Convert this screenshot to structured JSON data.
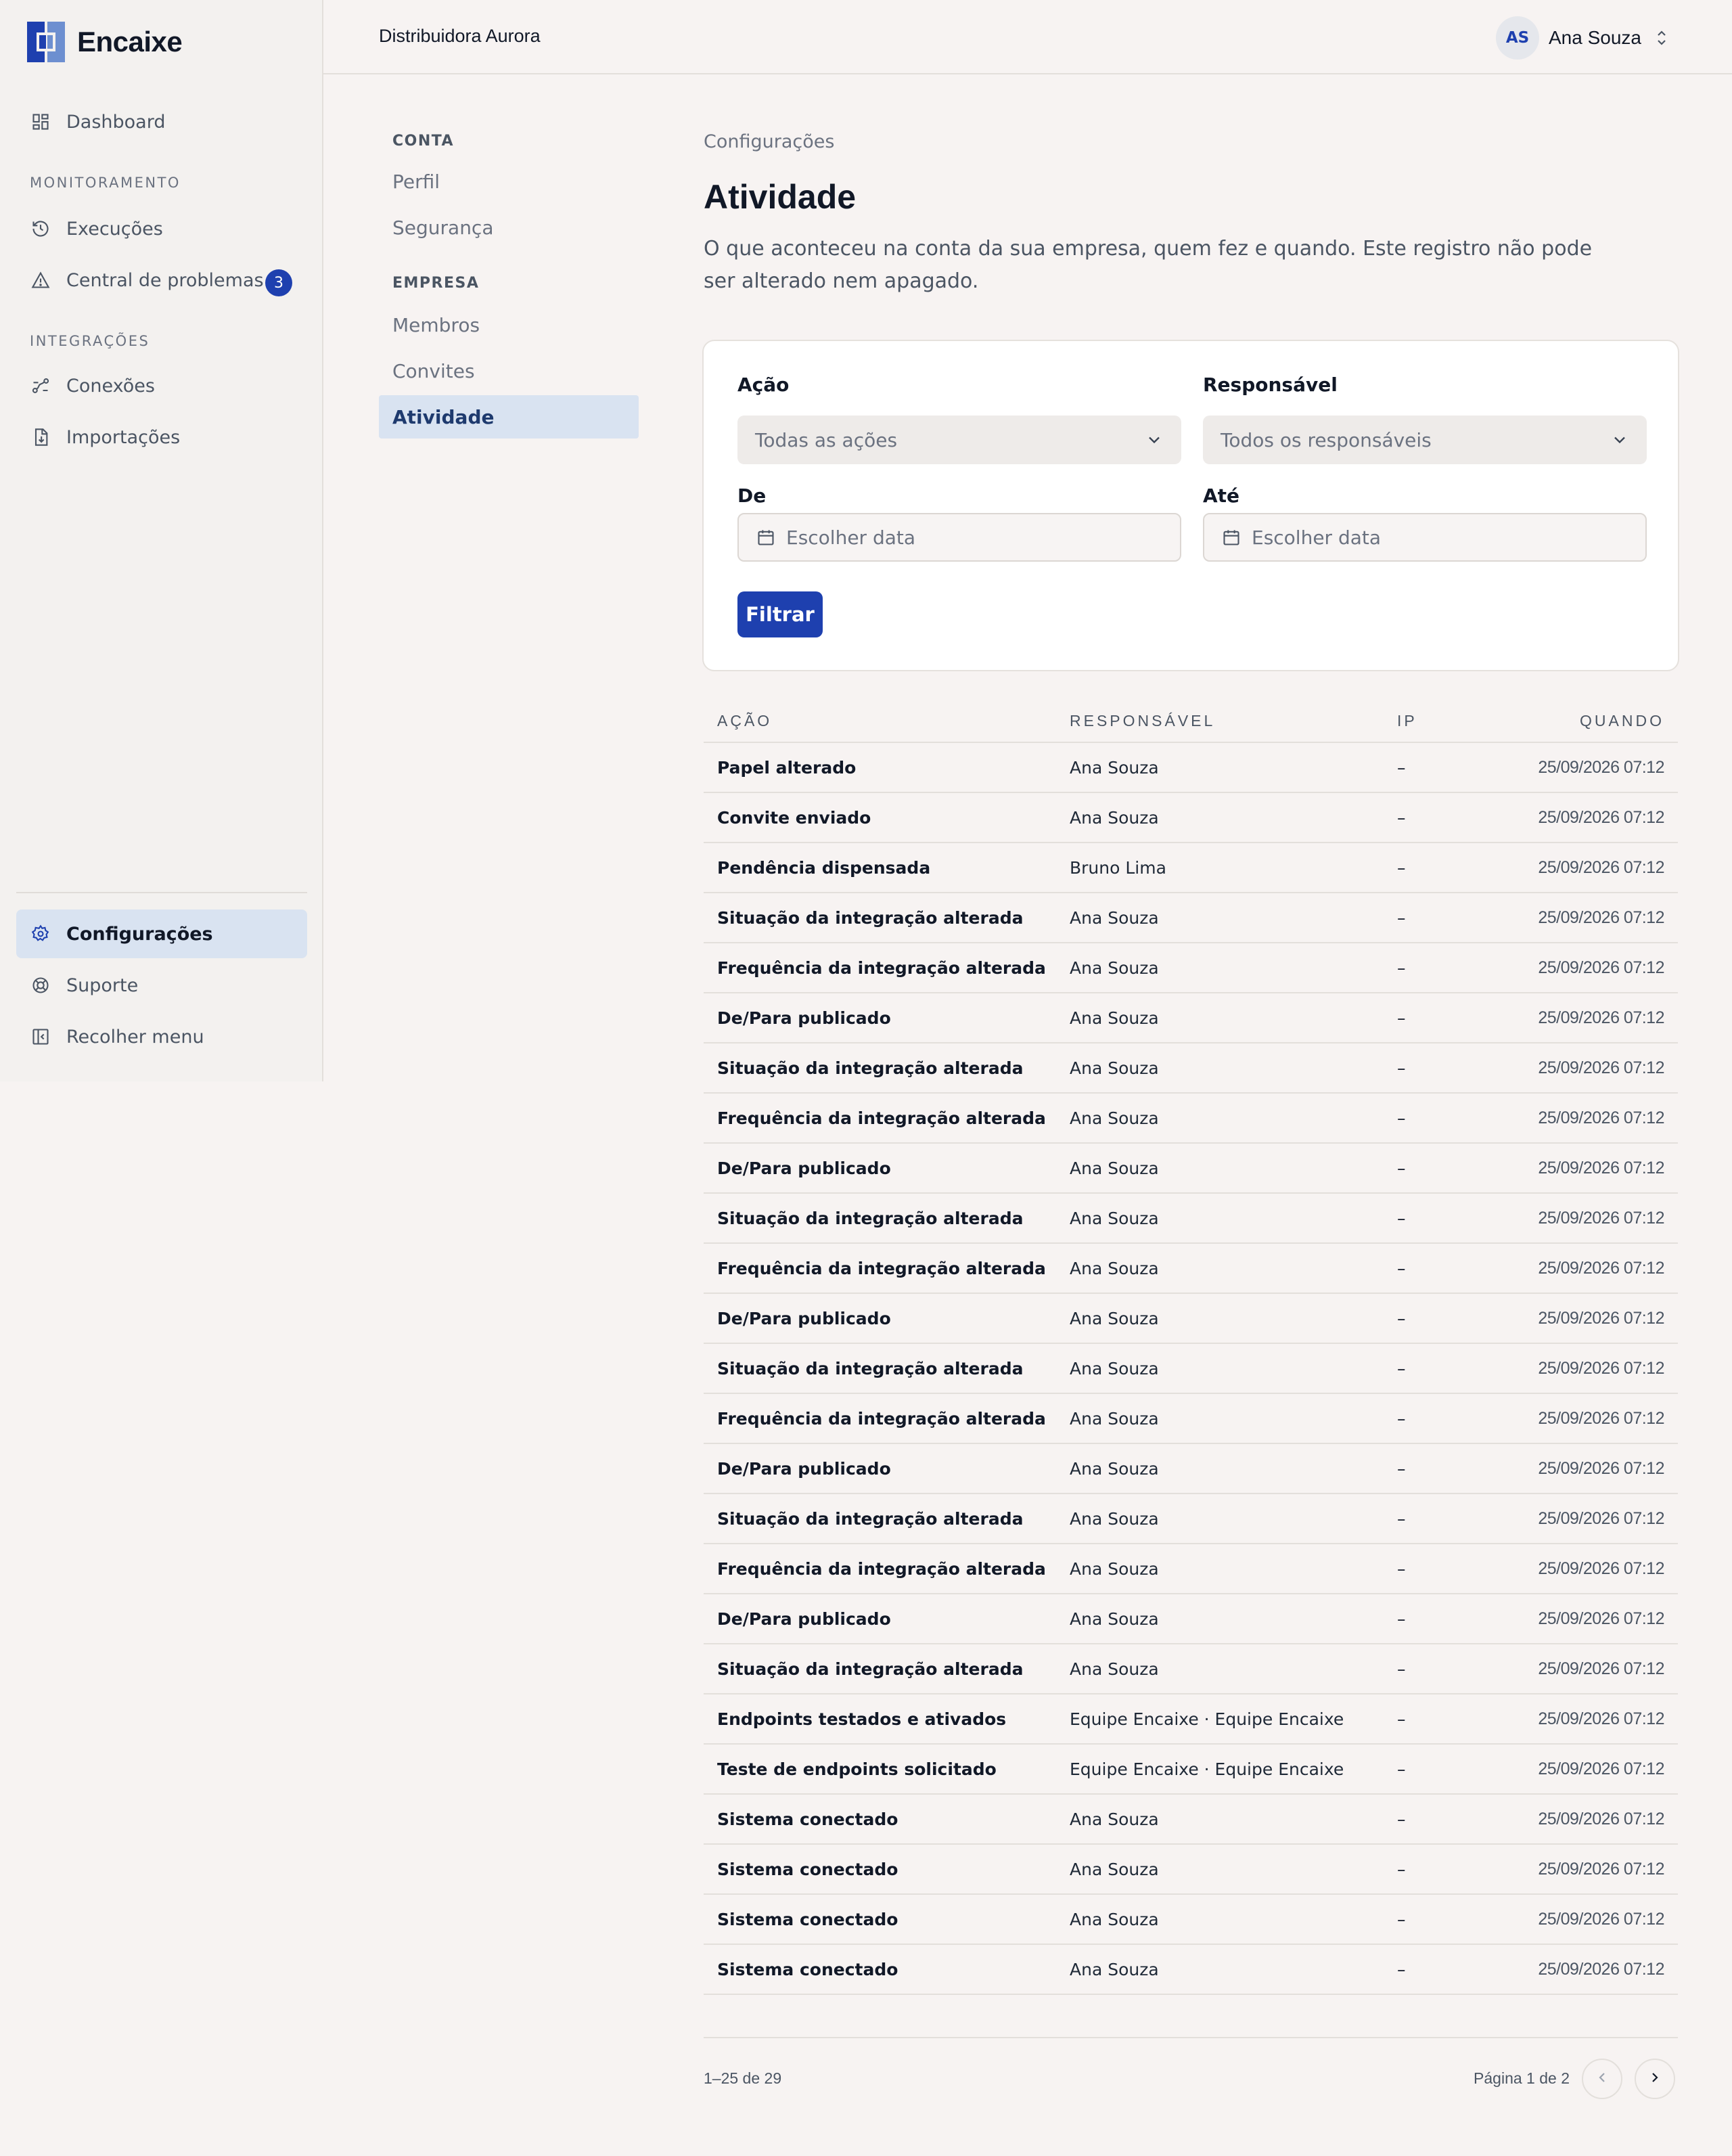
{
  "brand": {
    "name": "Encaixe"
  },
  "sidebar": {
    "dashboard": "Dashboard",
    "section_monitoring": "MONITORAMENTO",
    "executions": "Execuções",
    "problems": "Central de problemas",
    "problems_badge": "3",
    "section_integrations": "INTEGRAÇÕES",
    "connections": "Conexões",
    "imports": "Importações",
    "settings": "Configurações",
    "support": "Suporte",
    "collapse": "Recolher menu"
  },
  "header": {
    "org": "Distribuidora Aurora",
    "user_initials": "AS",
    "user_name": "Ana Souza"
  },
  "subnav": {
    "account_title": "CONTA",
    "profile": "Perfil",
    "security": "Segurança",
    "company_title": "EMPRESA",
    "members": "Membros",
    "invites": "Convites",
    "activity": "Atividade"
  },
  "main": {
    "breadcrumb": "Configurações",
    "title": "Atividade",
    "description": "O que aconteceu na conta da sua empresa, quem fez e quando. Este registro não pode ser alterado nem apagado."
  },
  "filters": {
    "action_label": "Ação",
    "action_value": "Todas as ações",
    "user_label": "Responsável",
    "user_value": "Todos os responsáveis",
    "from_label": "De",
    "from_placeholder": "Escolher data",
    "to_label": "Até",
    "to_placeholder": "Escolher data",
    "submit": "Filtrar"
  },
  "table": {
    "headers": {
      "action": "AÇÃO",
      "user": "RESPONSÁVEL",
      "ip": "IP",
      "when": "QUANDO"
    },
    "rows": [
      {
        "action": "Papel alterado",
        "user": "Ana Souza",
        "ip": "–",
        "when": "25/09/2026 07:12"
      },
      {
        "action": "Convite enviado",
        "user": "Ana Souza",
        "ip": "–",
        "when": "25/09/2026 07:12"
      },
      {
        "action": "Pendência dispensada",
        "user": "Bruno Lima",
        "ip": "–",
        "when": "25/09/2026 07:12"
      },
      {
        "action": "Situação da integração alterada",
        "user": "Ana Souza",
        "ip": "–",
        "when": "25/09/2026 07:12"
      },
      {
        "action": "Frequência da integração alterada",
        "user": "Ana Souza",
        "ip": "–",
        "when": "25/09/2026 07:12"
      },
      {
        "action": "De/Para publicado",
        "user": "Ana Souza",
        "ip": "–",
        "when": "25/09/2026 07:12"
      },
      {
        "action": "Situação da integração alterada",
        "user": "Ana Souza",
        "ip": "–",
        "when": "25/09/2026 07:12"
      },
      {
        "action": "Frequência da integração alterada",
        "user": "Ana Souza",
        "ip": "–",
        "when": "25/09/2026 07:12"
      },
      {
        "action": "De/Para publicado",
        "user": "Ana Souza",
        "ip": "–",
        "when": "25/09/2026 07:12"
      },
      {
        "action": "Situação da integração alterada",
        "user": "Ana Souza",
        "ip": "–",
        "when": "25/09/2026 07:12"
      },
      {
        "action": "Frequência da integração alterada",
        "user": "Ana Souza",
        "ip": "–",
        "when": "25/09/2026 07:12"
      },
      {
        "action": "De/Para publicado",
        "user": "Ana Souza",
        "ip": "–",
        "when": "25/09/2026 07:12"
      },
      {
        "action": "Situação da integração alterada",
        "user": "Ana Souza",
        "ip": "–",
        "when": "25/09/2026 07:12"
      },
      {
        "action": "Frequência da integração alterada",
        "user": "Ana Souza",
        "ip": "–",
        "when": "25/09/2026 07:12"
      },
      {
        "action": "De/Para publicado",
        "user": "Ana Souza",
        "ip": "–",
        "when": "25/09/2026 07:12"
      },
      {
        "action": "Situação da integração alterada",
        "user": "Ana Souza",
        "ip": "–",
        "when": "25/09/2026 07:12"
      },
      {
        "action": "Frequência da integração alterada",
        "user": "Ana Souza",
        "ip": "–",
        "when": "25/09/2026 07:12"
      },
      {
        "action": "De/Para publicado",
        "user": "Ana Souza",
        "ip": "–",
        "when": "25/09/2026 07:12"
      },
      {
        "action": "Situação da integração alterada",
        "user": "Ana Souza",
        "ip": "–",
        "when": "25/09/2026 07:12"
      },
      {
        "action": "Endpoints testados e ativados",
        "user": "Equipe Encaixe · Equipe Encaixe",
        "ip": "–",
        "when": "25/09/2026 07:12"
      },
      {
        "action": "Teste de endpoints solicitado",
        "user": "Equipe Encaixe · Equipe Encaixe",
        "ip": "–",
        "when": "25/09/2026 07:12"
      },
      {
        "action": "Sistema conectado",
        "user": "Ana Souza",
        "ip": "–",
        "when": "25/09/2026 07:12"
      },
      {
        "action": "Sistema conectado",
        "user": "Ana Souza",
        "ip": "–",
        "when": "25/09/2026 07:12"
      },
      {
        "action": "Sistema conectado",
        "user": "Ana Souza",
        "ip": "–",
        "when": "25/09/2026 07:12"
      },
      {
        "action": "Sistema conectado",
        "user": "Ana Souza",
        "ip": "–",
        "when": "25/09/2026 07:12"
      }
    ]
  },
  "pagination": {
    "range": "1–25 de 29",
    "page": "Página 1 de 2"
  },
  "colors": {
    "accent": "#1e40af",
    "active_bg": "#d9e3f1",
    "page_bg": "#f7f3f2"
  },
  "icons": [
    "dashboard-icon",
    "history-icon",
    "alert-triangle-icon",
    "connections-icon",
    "import-file-icon",
    "gear-icon",
    "lifebuoy-icon",
    "collapse-sidebar-icon",
    "chevron-down-icon",
    "calendar-icon",
    "chevron-left-icon",
    "chevron-right-icon",
    "chevron-updown-icon"
  ]
}
